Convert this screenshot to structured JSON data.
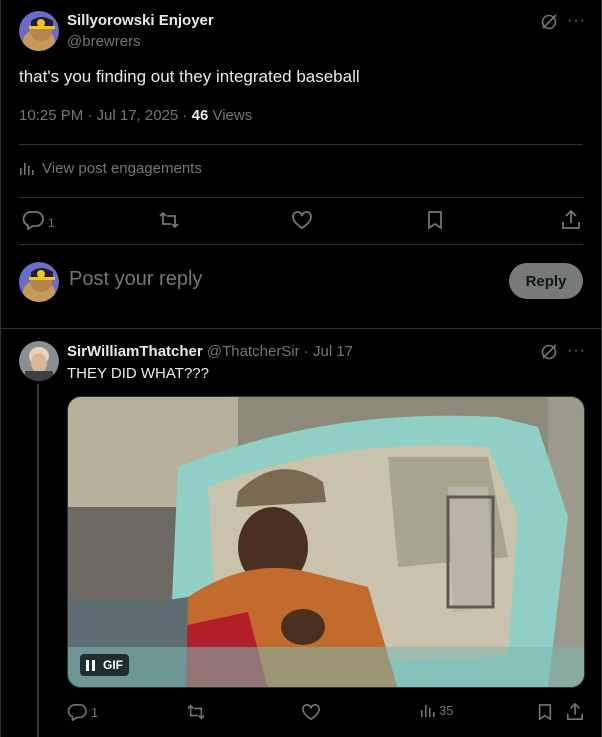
{
  "post": {
    "author_name": "Sillyorowski Enjoyer",
    "author_handle": "@brewrers",
    "text": "that's you finding out they integrated baseball",
    "time": "10:25 PM · Jul 17, 2025 · ",
    "views_count": "46",
    "views_label": " Views",
    "engagements_label": "View post engagements",
    "reply_count": "1",
    "more_icon": "···"
  },
  "composer": {
    "placeholder": "Post your reply",
    "reply_button": "Reply"
  },
  "reply": {
    "author_name": "SirWilliamThatcher",
    "author_meta": " @ThatcherSir · Jul 17",
    "text": "THEY DID WHAT???",
    "gif_label": "GIF",
    "reply_count": "1",
    "views_count": "35",
    "more_icon": "···"
  },
  "colors": {
    "background": "#000000",
    "text_primary": "#e7e9ea",
    "text_secondary": "#71767b",
    "border": "#2f3336",
    "reply_button_bg": "#787a7a"
  }
}
